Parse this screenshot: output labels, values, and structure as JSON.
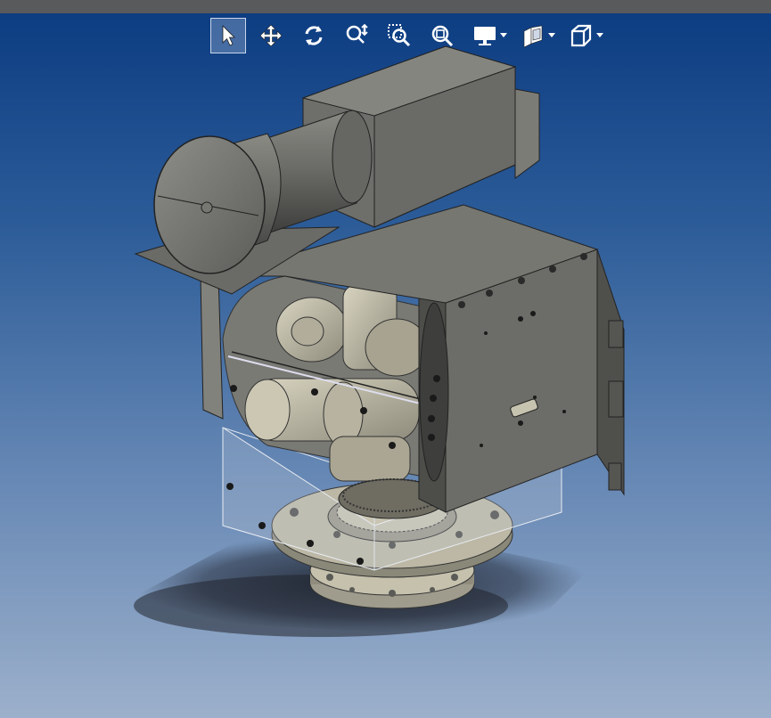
{
  "window": {
    "title": ""
  },
  "toolbar": {
    "tools": [
      {
        "id": "select",
        "icon": "select-arrow-icon",
        "active": true
      },
      {
        "id": "pan",
        "icon": "pan-move-icon",
        "active": false
      },
      {
        "id": "rotate",
        "icon": "rotate-icon",
        "active": false
      },
      {
        "id": "zoom",
        "icon": "zoom-icon",
        "active": false
      },
      {
        "id": "zoom-window",
        "icon": "zoom-window-icon",
        "active": false
      },
      {
        "id": "zoom-fit",
        "icon": "zoom-fit-icon",
        "active": false
      },
      {
        "id": "display",
        "icon": "display-monitor-icon",
        "active": false,
        "dropdown": true
      },
      {
        "id": "section",
        "icon": "section-view-icon",
        "active": false,
        "dropdown": true
      },
      {
        "id": "view-cube",
        "icon": "view-cube-icon",
        "active": false,
        "dropdown": true
      }
    ]
  },
  "colors": {
    "bg_top": "#0d3d82",
    "bg_bottom": "#9cb0cb",
    "model_body": "#6e6e6a",
    "model_light": "#b9b6a3",
    "model_dark": "#4e4e4b",
    "icon": "#ffffff"
  },
  "model": {
    "name": "3d-cad-assembly"
  }
}
